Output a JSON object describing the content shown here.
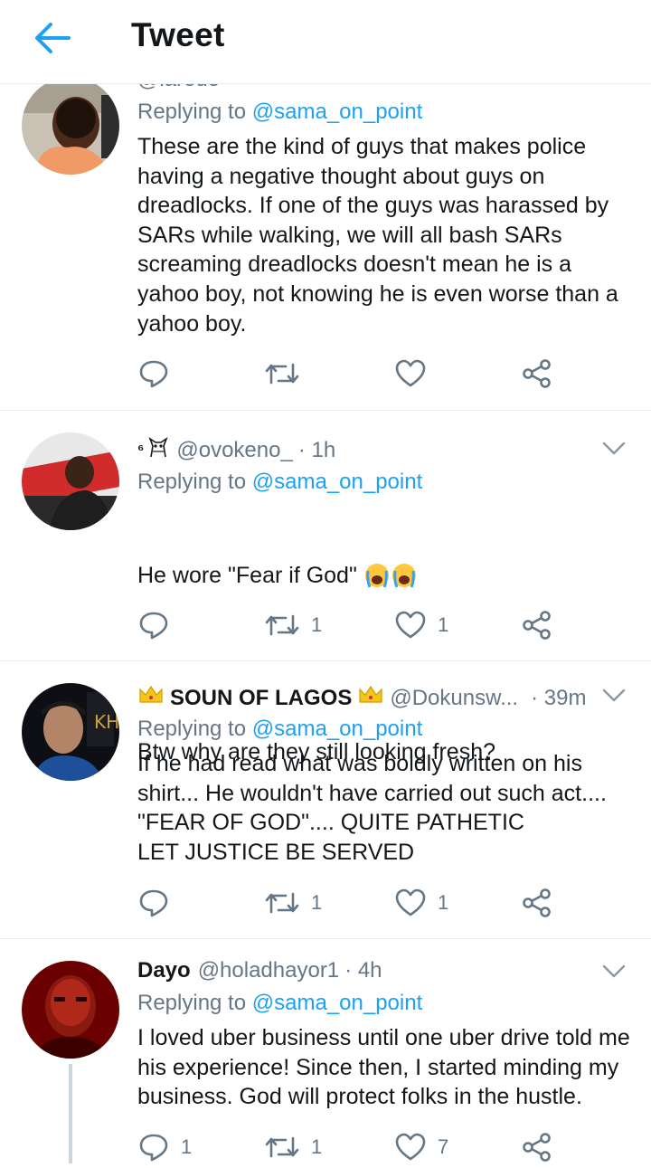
{
  "header": {
    "title": "Tweet"
  },
  "tweets": [
    {
      "name": "",
      "handle": "@laredo",
      "time": "",
      "reply_prefix": "Replying to ",
      "reply_to": "@sama_on_point",
      "text": "These are the kind of guys that makes police having a negative thought about guys on dreadlocks. If one of the guys was harassed by SARs while walking, we will all bash SARs screaming dreadlocks doesn't mean he is a yahoo boy, not knowing he is even worse than a yahoo boy.",
      "replies": "",
      "retweets": "",
      "likes": ""
    },
    {
      "name_prefix": "⁶",
      "handle": "@ovokeno_",
      "time": "· 1h",
      "reply_prefix": "Replying to ",
      "reply_to": "@sama_on_point",
      "text_line1": "He wore \"Fear if God\"",
      "text_line2": "Btw why are they still looking fresh?",
      "replies": "",
      "retweets": "1",
      "likes": "1"
    },
    {
      "name": "SOUN OF LAGOS",
      "handle": "@Dokunsw...",
      "time": "· 39m",
      "reply_prefix": "Replying to ",
      "reply_to": "@sama_on_point",
      "text": "If he had read what was boldly written on his shirt... He wouldn't have carried out such act....\n\"FEAR OF GOD\".... QUITE PATHETIC\nLET JUSTICE BE SERVED",
      "replies": "",
      "retweets": "1",
      "likes": "1"
    },
    {
      "name": "Dayo",
      "handle": "@holadhayor1",
      "time": "· 4h",
      "reply_prefix": "Replying to ",
      "reply_to": "@sama_on_point",
      "text": "I loved uber business until one uber drive told me his experience! Since then, I started minding my business. God will protect folks in the hustle.",
      "replies": "1",
      "retweets": "1",
      "likes": "7"
    }
  ],
  "colors": {
    "accent": "#1da1f2",
    "muted": "#657786",
    "text": "#14171a",
    "divider": "#e6ecf0"
  }
}
